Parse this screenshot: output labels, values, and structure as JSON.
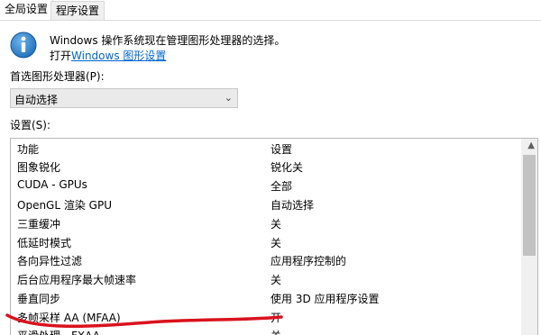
{
  "tabs": [
    "全局设置",
    "程序设置"
  ],
  "info": {
    "line1": "Windows 操作系统现在管理图形处理器的选择。",
    "line2_prefix": "打开",
    "line2_link": "Windows 图形设置"
  },
  "preferred_gpu": {
    "label": "首选图形处理器(P):",
    "value": "自动选择"
  },
  "settings_label": "设置(S):",
  "table": {
    "headers": [
      "功能",
      "设置"
    ],
    "rows": [
      [
        "图象锐化",
        "锐化关"
      ],
      [
        "CUDA - GPUs",
        "全部"
      ],
      [
        "OpenGL 渲染 GPU",
        "自动选择"
      ],
      [
        "三重缓冲",
        "关"
      ],
      [
        "低延时模式",
        "关"
      ],
      [
        "各向异性过滤",
        "应用程序控制的"
      ],
      [
        "后台应用程序最大帧速率",
        "关"
      ],
      [
        "垂直同步",
        "使用 3D 应用程序设置"
      ],
      [
        "多帧采样 AA (MFAA)",
        "开"
      ],
      [
        "平滑处理 - FXAA",
        "关"
      ]
    ]
  },
  "colors": {
    "link": "#0066cc",
    "annotation": "#d9131e",
    "info_blue": "#1e6fb8"
  }
}
